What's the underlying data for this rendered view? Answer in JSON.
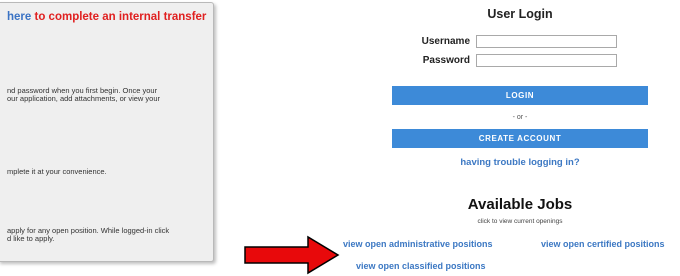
{
  "left_panel": {
    "here_link": "here",
    "transfer_text": "to complete an internal transfer",
    "para1": [
      "nd password when you first begin. Once your",
      "our application, add attachments, or view your"
    ],
    "para2": [
      "mplete it at your convenience."
    ],
    "para3": [
      "apply for any open position. While logged-in click",
      "d like to apply."
    ]
  },
  "login": {
    "title": "User Login",
    "username_label": "Username",
    "password_label": "Password",
    "username_value": "",
    "password_value": "",
    "login_button": "LOGIN",
    "or_text": "- or -",
    "create_account_button": "CREATE ACCOUNT",
    "trouble_link": "having trouble logging in?"
  },
  "jobs": {
    "title": "Available Jobs",
    "subtitle": "click to view current openings",
    "administrative": "view open administrative positions",
    "certified": "view open certified positions",
    "classified": "view open classified positions"
  },
  "colors": {
    "accent_blue": "#3d8ad8",
    "link_blue": "#3c78c3",
    "alert_red": "#e02020",
    "arrow_red": "#e8090b"
  },
  "icons": {
    "arrow": "red-right-arrow"
  }
}
